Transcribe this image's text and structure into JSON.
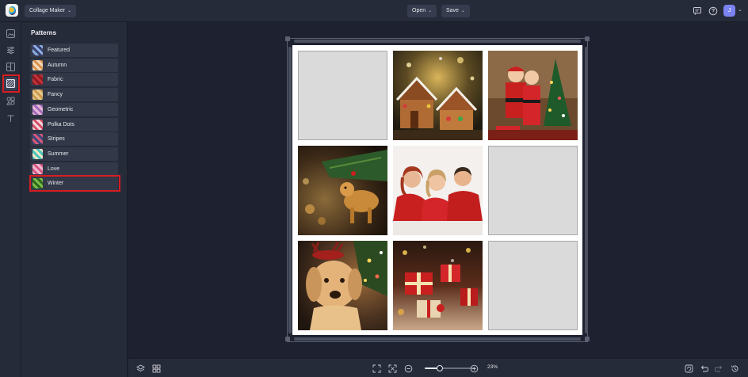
{
  "header": {
    "app_menu_label": "Collage Maker",
    "open_label": "Open",
    "save_label": "Save",
    "avatar_initial": "J",
    "icons": [
      "comment-icon",
      "help-icon"
    ]
  },
  "rail": {
    "icons": [
      "image-icon",
      "sliders-icon",
      "layout-icon",
      "pattern-icon",
      "graphics-icon",
      "text-icon"
    ],
    "active": "pattern-icon"
  },
  "panel": {
    "title": "Patterns",
    "items": [
      {
        "label": "Featured",
        "thumb_colors": [
          "#3d4470",
          "#8fb3e8"
        ]
      },
      {
        "label": "Autumn",
        "thumb_colors": [
          "#f3d9b8",
          "#d9914a"
        ]
      },
      {
        "label": "Fabric",
        "thumb_colors": [
          "#8e1b22",
          "#c7323a"
        ]
      },
      {
        "label": "Fancy",
        "thumb_colors": [
          "#e9c98e",
          "#c89a4d"
        ]
      },
      {
        "label": "Geometric",
        "thumb_colors": [
          "#e7b4d8",
          "#9f6bb8"
        ]
      },
      {
        "label": "Polka Dots",
        "thumb_colors": [
          "#f4d3d9",
          "#d44a64"
        ]
      },
      {
        "label": "Stripes",
        "thumb_colors": [
          "#3e4a78",
          "#e0577a"
        ]
      },
      {
        "label": "Summer",
        "thumb_colors": [
          "#4fc4c0",
          "#f4e7c2"
        ]
      },
      {
        "label": "Love",
        "thumb_colors": [
          "#f0b6cf",
          "#d4567f"
        ]
      },
      {
        "label": "Winter",
        "thumb_colors": [
          "#2e6b1f",
          "#7fbf4a"
        ]
      }
    ],
    "selected": "Winter"
  },
  "collage": {
    "cells": [
      {
        "type": "empty"
      },
      {
        "type": "photo",
        "subject": "gingerbread houses"
      },
      {
        "type": "photo",
        "subject": "kids in santa suits by christmas tree"
      },
      {
        "type": "photo",
        "subject": "golden dog ornament on tree"
      },
      {
        "type": "photo",
        "subject": "family in red sweaters"
      },
      {
        "type": "empty"
      },
      {
        "type": "photo",
        "subject": "golden retriever with reindeer antlers"
      },
      {
        "type": "photo",
        "subject": "wrapped red gift boxes"
      },
      {
        "type": "empty"
      }
    ]
  },
  "footer": {
    "zoom_label": "23%",
    "zoom_value": 0.3
  },
  "colors": {
    "accent": "#7b83f0",
    "highlight": "#d81d22",
    "panel_bg": "#262b39",
    "canvas_bg": "#1e2230"
  }
}
